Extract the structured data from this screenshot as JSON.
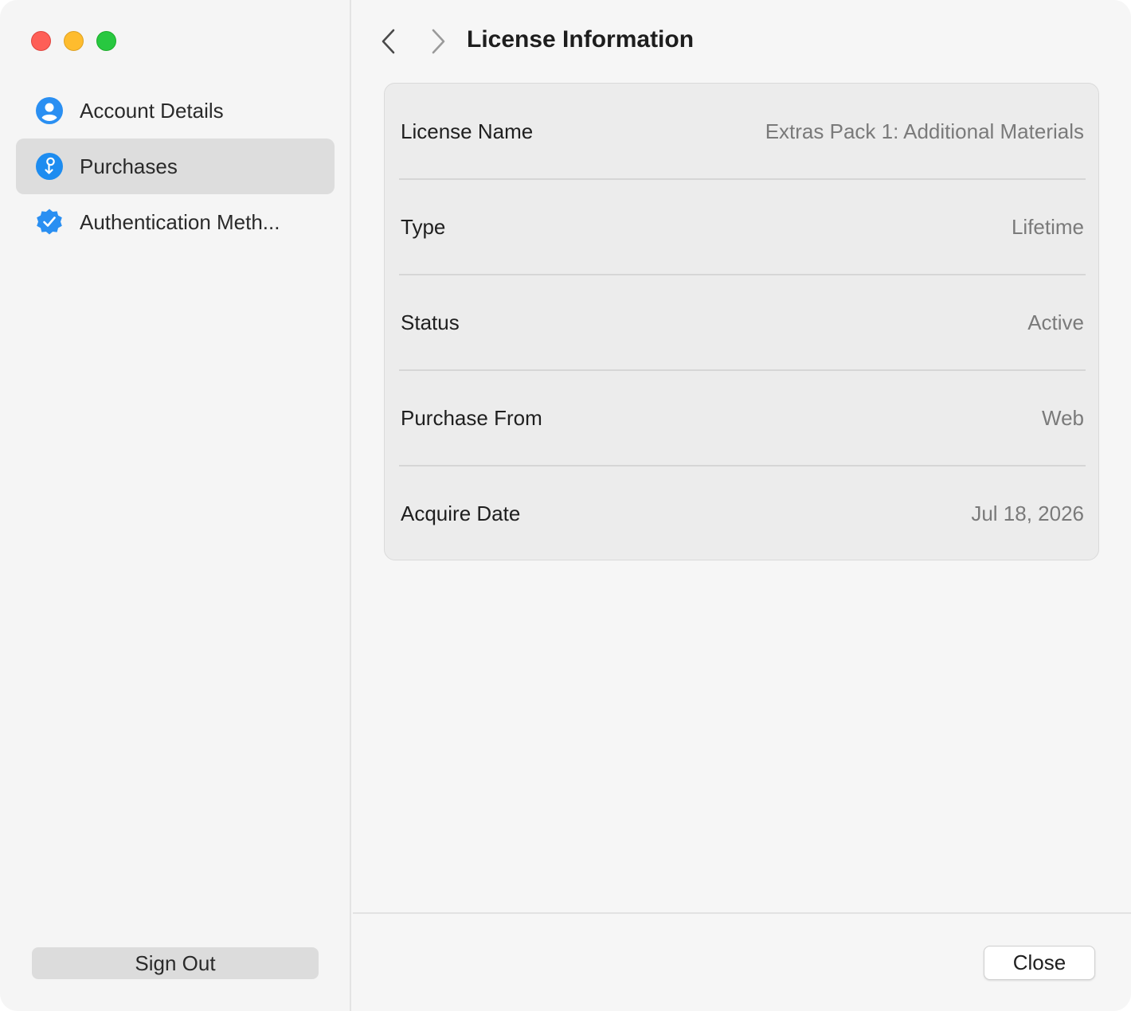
{
  "window": {
    "controls": [
      "close",
      "minimize",
      "zoom"
    ]
  },
  "sidebar": {
    "items": [
      {
        "label": "Account Details",
        "icon": "person-circle-icon",
        "selected": false
      },
      {
        "label": "Purchases",
        "icon": "purchase-icon",
        "selected": true
      },
      {
        "label": "Authentication Meth...",
        "icon": "verified-badge-icon",
        "selected": false
      }
    ],
    "sign_out_label": "Sign Out"
  },
  "header": {
    "title": "License Information",
    "back_icon": "chevron-left-icon",
    "forward_icon": "chevron-right-icon"
  },
  "license": {
    "rows": [
      {
        "label": "License Name",
        "value": "Extras Pack 1: Additional Materials"
      },
      {
        "label": "Type",
        "value": "Lifetime"
      },
      {
        "label": "Status",
        "value": "Active"
      },
      {
        "label": "Purchase From",
        "value": "Web"
      },
      {
        "label": "Acquire Date",
        "value": "Jul 18, 2026"
      }
    ]
  },
  "footer": {
    "close_label": "Close"
  },
  "colors": {
    "accent": "#1d8cf0",
    "selected_bg": "#dddddd",
    "value_text": "#7a7a7a"
  }
}
